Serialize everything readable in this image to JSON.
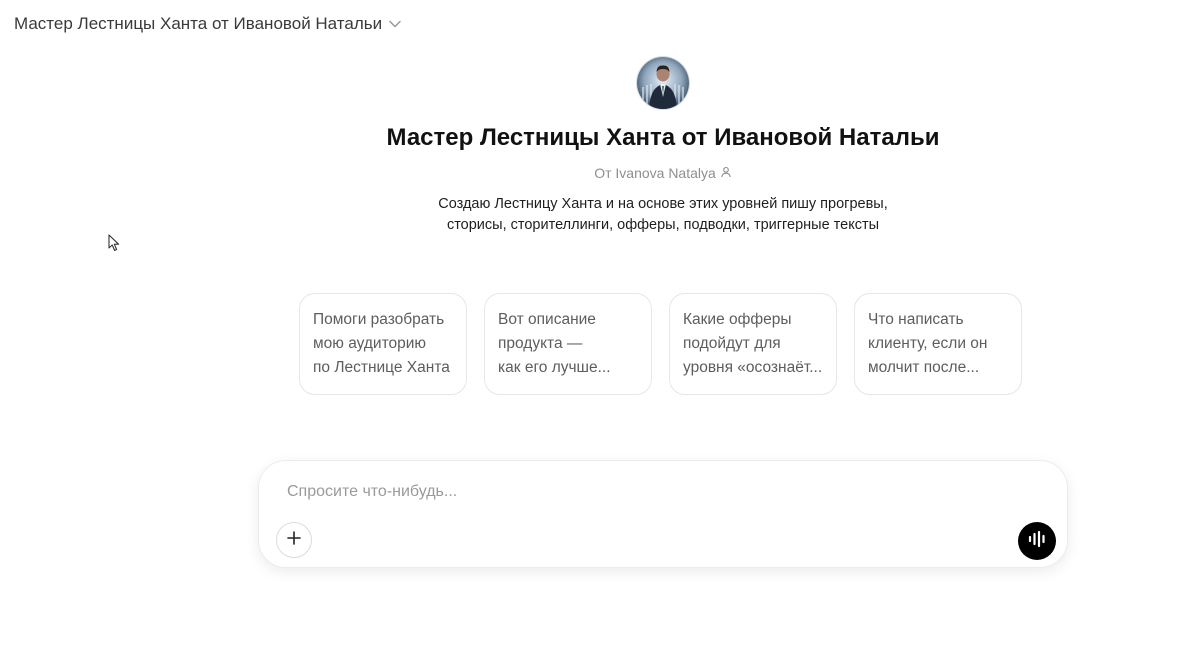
{
  "header": {
    "title": "Мастер Лестницы Ханта от Ивановой Натальи",
    "chevron_icon": "chevron-down-icon"
  },
  "gpt": {
    "avatar_icon": "profile-portrait",
    "title": "Мастер Лестницы Ханта от Ивановой Натальи",
    "author": "От Ivanova Natalya",
    "author_icon": "person-icon",
    "description_line1": "Создаю Лестницу Ханта и на основе этих уровней пишу прогревы,",
    "description_line2": "сторисы, сторителлинги, офферы, подводки, триггерные тексты"
  },
  "starters": [
    {
      "lines": [
        "Помоги разобрать",
        "мою аудиторию",
        "по Лестнице Ханта"
      ]
    },
    {
      "lines": [
        "Вот описание",
        "продукта —",
        "как его лучше..."
      ]
    },
    {
      "lines": [
        "Какие офферы",
        "подойдут для",
        "уровня «осознаёт..."
      ]
    },
    {
      "lines": [
        "Что написать",
        "клиенту, если он",
        "молчит после..."
      ]
    }
  ],
  "composer": {
    "placeholder": "Спросите что-нибудь...",
    "value": "",
    "plus_icon": "plus-icon",
    "voice_icon": "voice-waveform-icon"
  },
  "colors": {
    "background": "#ffffff",
    "text_primary": "#111111",
    "text_secondary": "#8f8f8f",
    "card_border": "#e6e6e6",
    "voice_button": "#000000"
  }
}
